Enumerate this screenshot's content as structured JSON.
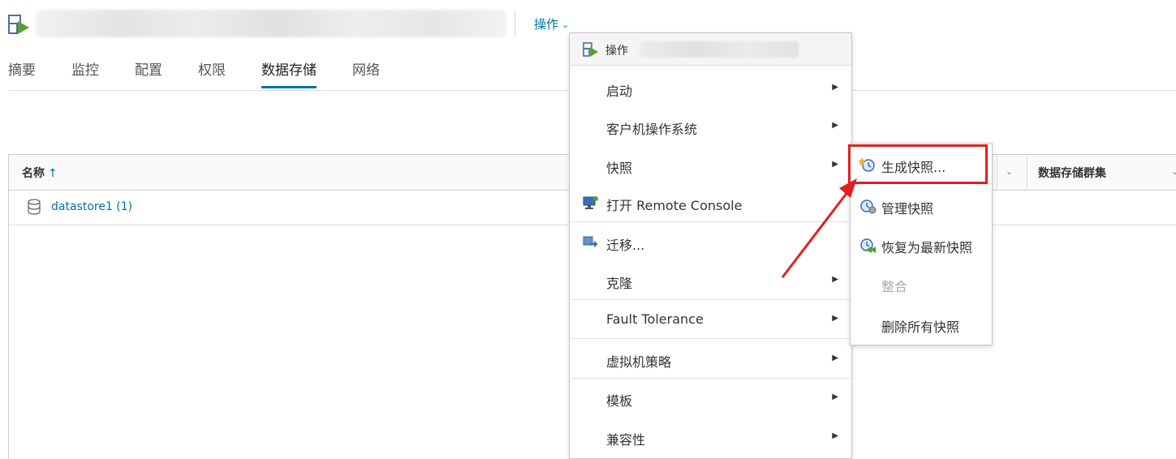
{
  "header": {
    "actions_label": "操作"
  },
  "tabs": [
    {
      "label": "摘要"
    },
    {
      "label": "监控"
    },
    {
      "label": "配置"
    },
    {
      "label": "权限"
    },
    {
      "label": "数据存储"
    },
    {
      "label": "网络"
    }
  ],
  "active_tab": "数据存储",
  "grid": {
    "columns": {
      "name": "名称",
      "name_sort": "↑",
      "datastore_cluster": "数据存储群集"
    },
    "rows": [
      {
        "name": "datastore1 (1)"
      }
    ]
  },
  "menu": {
    "header_label": "操作",
    "items": [
      {
        "label": "启动",
        "submenu": true
      },
      {
        "label": "客户机操作系统",
        "submenu": true
      },
      {
        "label": "快照",
        "submenu": true,
        "icon": "none"
      },
      {
        "label": "打开 Remote Console",
        "submenu": false,
        "icon": "console-icon"
      },
      {
        "label": "迁移...",
        "submenu": false,
        "icon": "migrate-icon"
      },
      {
        "label": "克隆",
        "submenu": true
      },
      {
        "label": "Fault Tolerance",
        "submenu": true
      },
      {
        "label": "虚拟机策略",
        "submenu": true
      },
      {
        "label": "模板",
        "submenu": true
      },
      {
        "label": "兼容性",
        "submenu": true
      }
    ],
    "submenu_arrow": "▶"
  },
  "snapshot_submenu": {
    "items": [
      {
        "label": "生成快照...",
        "icon": "take-snapshot-icon",
        "enabled": true
      },
      {
        "label": "管理快照",
        "icon": "manage-snapshots-icon",
        "enabled": true
      },
      {
        "label": "恢复为最新快照",
        "icon": "revert-snapshot-icon",
        "enabled": true
      },
      {
        "label": "整合",
        "icon": "none",
        "enabled": false
      },
      {
        "label": "删除所有快照",
        "icon": "none",
        "enabled": true
      }
    ]
  },
  "colors": {
    "link": "#0072a3",
    "annotation_red": "#e02020",
    "vm_green": "#5aa02c"
  }
}
